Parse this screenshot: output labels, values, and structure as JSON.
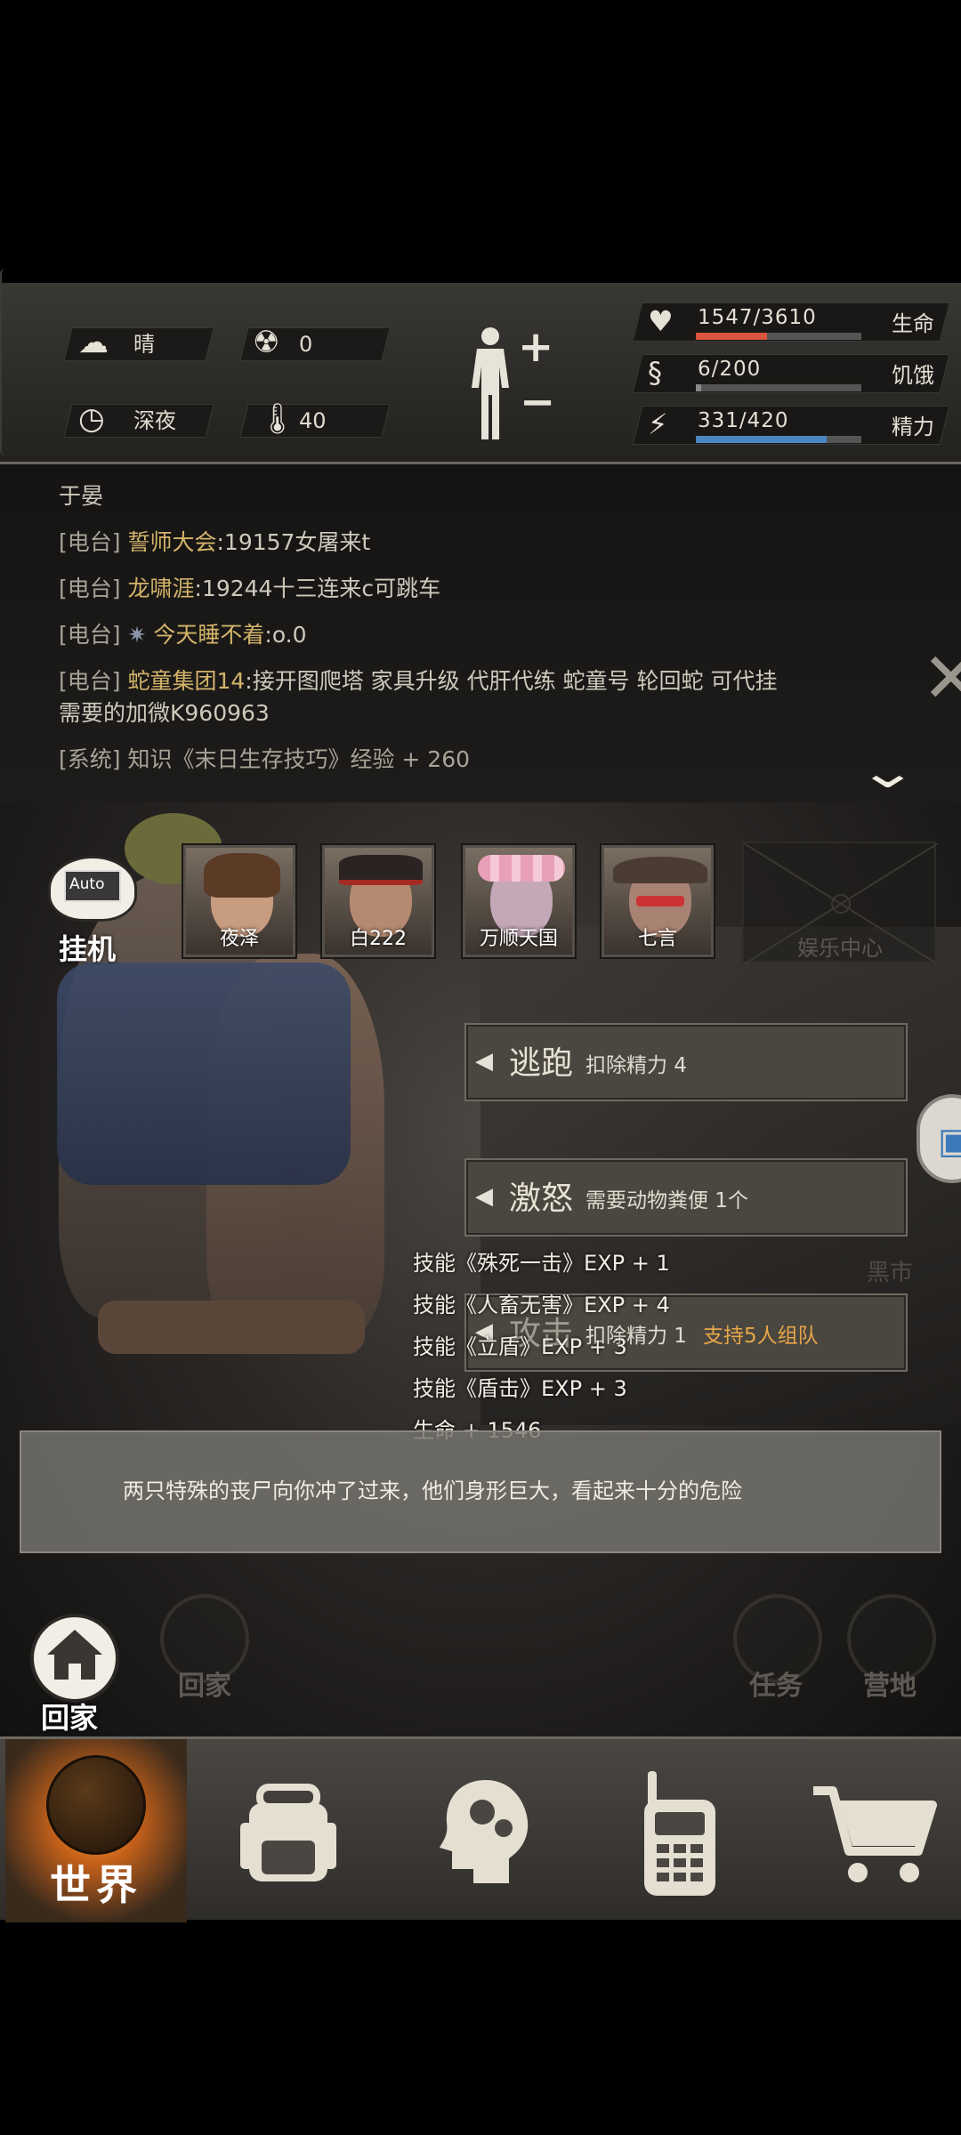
{
  "status": {
    "weather": "晴",
    "time_of_day": "深夜",
    "radiation": "0",
    "temperature": "40",
    "health_text": "1547/3610",
    "health_label": "生命",
    "health_ratio": 0.428,
    "hunger_text": "6/200",
    "hunger_label": "饥饿",
    "hunger_ratio": 0.03,
    "energy_text": "331/420",
    "energy_label": "精力",
    "energy_ratio": 0.788,
    "colors": {
      "health": "#d9553e",
      "hunger": "#8a8a8a",
      "energy": "#4a86c2"
    },
    "icons": [
      "cloud-sun-icon",
      "radiation-icon",
      "clock-icon",
      "thermometer-icon",
      "body-icon",
      "heart-icon",
      "stomach-icon",
      "brain-icon"
    ]
  },
  "log": {
    "header": "于晏",
    "lines": [
      {
        "tag": "[电台]",
        "name": "誓师大会",
        "text": ":19157女屠来t"
      },
      {
        "tag": "[电台]",
        "name": "龙啸涯",
        "text": ":19244十三连来c可跳车"
      },
      {
        "tag": "[电台]",
        "name": "今天睡不着",
        "text": ":o.0"
      },
      {
        "tag": "[电台]",
        "name": "蛇童集团14",
        "text": ":接开图爬塔 家具升级 代肝代练 蛇童号 轮回蛇 可代挂"
      }
    ],
    "line4_cont": "需要的加微K960963",
    "system_tag": "[系统]",
    "system_text": "知识《末日生存技巧》经验 + 260"
  },
  "battle": {
    "auto_label": "Auto",
    "idle_label": "挂机",
    "team": [
      "夜泽",
      "白222",
      "万顺天国",
      "七言"
    ],
    "entertainment": "娱乐中心",
    "flee_label": "逃跑",
    "flee_desc": "扣除精力 4",
    "rage_label": "激怒",
    "rage_desc": "需要动物粪便 1个",
    "attack_label": "攻击",
    "attack_desc": "扣除精力 1",
    "attack_team": "支持5人组队",
    "black_market": "黑市",
    "exp_lines": [
      "技能《殊死一击》EXP + 1",
      "技能《人畜无害》EXP + 4",
      "技能《立盾》EXP + 3",
      "技能《盾击》EXP + 3",
      "生命 + 1546"
    ],
    "story": "两只特殊的丧尸向你冲了过来，他们身形巨大，看起来十分的危险",
    "home_label": "回家",
    "ghost_home": "回家",
    "ghost_task": "任务",
    "ghost_camp": "营地"
  },
  "nav": {
    "world_label": "世界",
    "items": [
      "globe-icon",
      "backpack-icon",
      "head-gears-icon",
      "walkie-talkie-icon",
      "shopping-cart-icon"
    ]
  }
}
